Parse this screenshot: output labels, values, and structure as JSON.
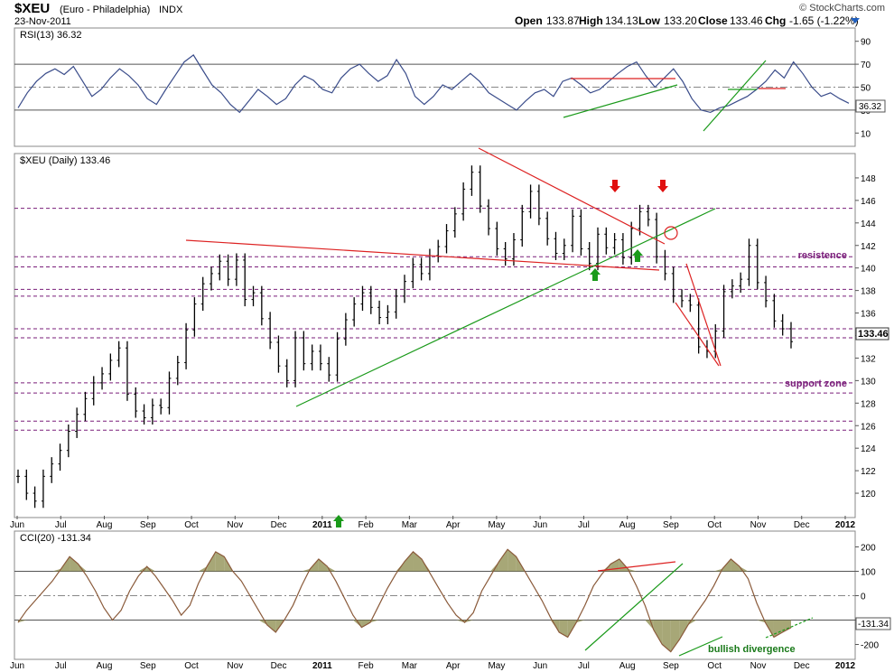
{
  "header": {
    "symbol": "$XEU",
    "name": "(Euro - Philadelphia)",
    "exchange": "INDX",
    "date": "23-Nov-2011",
    "watermark": "© StockCharts.com",
    "open_label": "Open",
    "open": "133.87",
    "high_label": "High",
    "high": "134.13",
    "low_label": "Low",
    "low": "133.20",
    "close_label": "Close",
    "close": "133.46",
    "chg_label": "Chg",
    "chg": "-1.65 (-1.22%)"
  },
  "chart_data": [
    {
      "type": "line",
      "panel": "rsi",
      "title": "RSI(13) 36.32",
      "ylim": [
        0,
        100
      ],
      "yticks": [
        10,
        30,
        50,
        70,
        90
      ],
      "reference_lines": [
        30,
        50,
        70
      ],
      "last_value_label": "36.32",
      "series": [
        {
          "values": [
            32,
            45,
            55,
            62,
            66,
            61,
            68,
            55,
            42,
            48,
            58,
            66,
            60,
            52,
            40,
            35,
            48,
            60,
            72,
            78,
            65,
            52,
            45,
            35,
            28,
            38,
            48,
            42,
            35,
            40,
            52,
            60,
            56,
            48,
            45,
            58,
            66,
            70,
            62,
            55,
            60,
            74,
            62,
            42,
            35,
            42,
            52,
            48,
            55,
            62,
            55,
            45,
            40,
            35,
            30,
            38,
            45,
            48,
            42,
            55,
            58,
            52,
            45,
            48,
            55,
            62,
            68,
            72,
            60,
            50,
            58,
            66,
            55,
            40,
            30,
            28,
            32,
            34,
            38,
            42,
            48,
            55,
            65,
            58,
            72,
            62,
            50,
            42,
            45,
            40,
            36
          ]
        }
      ]
    },
    {
      "type": "bar",
      "panel": "price",
      "title": "$XEU (Daily) 133.46",
      "ylim": [
        118,
        150
      ],
      "yticks": [
        120,
        122,
        124,
        126,
        128,
        130,
        132,
        134,
        136,
        138,
        140,
        142,
        144,
        146,
        148
      ],
      "xlabels": [
        "Jun",
        "Jul",
        "Aug",
        "Sep",
        "Oct",
        "Nov",
        "Dec",
        "2011",
        "Feb",
        "Mar",
        "Apr",
        "May",
        "Jun",
        "Jul",
        "Aug",
        "Sep",
        "Oct",
        "Nov",
        "Dec",
        "2012"
      ],
      "last_price_label": "133.46",
      "horizontal_levels": [
        145.3,
        141.0,
        140.1,
        138.1,
        137.5,
        134.6,
        133.8,
        129.8,
        128.9,
        126.4,
        125.6
      ],
      "annotations": [
        {
          "text": "resistence",
          "y": 140.5
        },
        {
          "text": "support zone",
          "y": 129.4
        }
      ],
      "series": [
        {
          "name": "close",
          "values": [
            121.5,
            120.0,
            119.3,
            121.5,
            122.6,
            123.8,
            125.5,
            127.0,
            128.4,
            129.8,
            130.6,
            131.8,
            132.9,
            128.8,
            127.3,
            126.7,
            127.8,
            127.6,
            130.2,
            131.6,
            134.5,
            136.8,
            138.6,
            139.5,
            140.6,
            139.0,
            140.7,
            137.2,
            137.8,
            135.5,
            133.4,
            131.3,
            130.0,
            133.8,
            131.5,
            132.6,
            131.5,
            130.5,
            133.7,
            135.4,
            136.8,
            137.8,
            136.5,
            135.6,
            136.1,
            137.5,
            138.8,
            140.3,
            139.5,
            141.1,
            141.9,
            143.3,
            144.8,
            147.0,
            148.5,
            145.5,
            143.5,
            141.7,
            140.8,
            142.5,
            145.0,
            146.8,
            144.4,
            142.6,
            141.3,
            142.0,
            144.6,
            141.7,
            140.4,
            143.0,
            141.8,
            142.5,
            140.9,
            143.5,
            145.0,
            144.3,
            141.0,
            139.5,
            137.5,
            137.1,
            136.7,
            133.0,
            132.6,
            134.4,
            137.9,
            138.4,
            139.0,
            142.0,
            138.7,
            137.1,
            135.3,
            134.6,
            133.46
          ]
        }
      ]
    },
    {
      "type": "line",
      "panel": "cci",
      "title": "CCI(20) -131.34",
      "ylim": [
        -250,
        250
      ],
      "yticks": [
        -200,
        -100,
        0,
        100,
        200
      ],
      "reference_lines": [
        -100,
        0,
        100
      ],
      "last_value_label": "-131.34",
      "annotations": [
        {
          "text": "bullish divergence"
        }
      ],
      "series": [
        {
          "values": [
            -110,
            -60,
            -20,
            20,
            60,
            110,
            160,
            130,
            80,
            20,
            -50,
            -100,
            -60,
            20,
            80,
            120,
            80,
            30,
            -20,
            -80,
            -40,
            50,
            120,
            180,
            160,
            100,
            60,
            0,
            -60,
            -120,
            -150,
            -100,
            -40,
            40,
            110,
            150,
            120,
            60,
            -10,
            -80,
            -130,
            -110,
            -40,
            30,
            90,
            140,
            180,
            150,
            90,
            30,
            -30,
            -80,
            -110,
            -70,
            20,
            80,
            140,
            190,
            160,
            100,
            40,
            -20,
            -90,
            -150,
            -170,
            -110,
            -40,
            40,
            90,
            130,
            150,
            110,
            40,
            -40,
            -140,
            -200,
            -230,
            -180,
            -120,
            -70,
            -20,
            40,
            110,
            150,
            120,
            70,
            -30,
            -110,
            -170,
            -150,
            -131
          ]
        }
      ]
    }
  ]
}
